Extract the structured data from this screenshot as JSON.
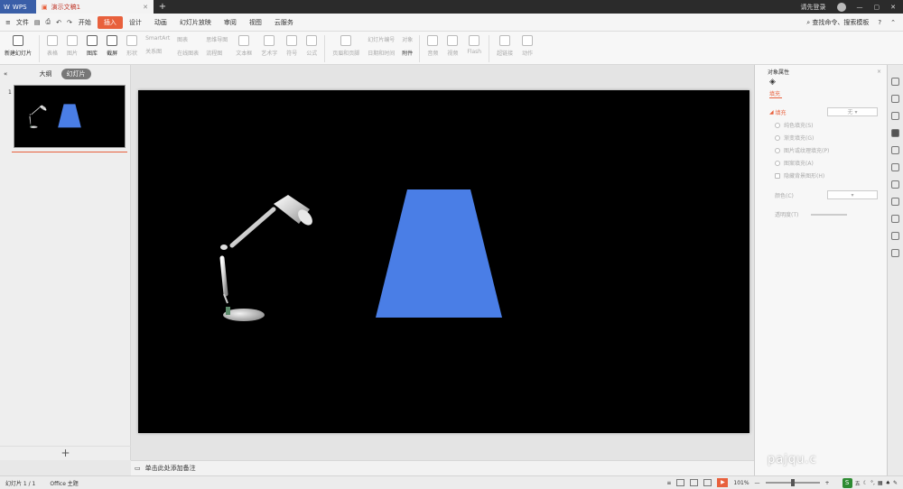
{
  "titlebar": {
    "app_tab": "WPS",
    "doc_tab": "演示文稿1",
    "new_tab": "+",
    "login": "请先登录",
    "controls": [
      "—",
      "▢",
      "✕"
    ]
  },
  "menubar": {
    "file": "文件",
    "items": [
      "开始",
      "插入",
      "设计",
      "动画",
      "幻灯片放映",
      "审阅",
      "视图",
      "云服务"
    ],
    "active": "插入",
    "search": "查找命令、搜索模板",
    "help": "?"
  },
  "ribbon": {
    "new_slide": "新建幻灯片",
    "table": "表格",
    "picture": "图片",
    "gallery": "图库",
    "screenshot": "截屏",
    "shape": "形状",
    "smartart": "SmartArt",
    "relation": "关系图",
    "chart": "图表",
    "online_chart": "在线图表",
    "mindmap": "思维导图",
    "flowchart": "流程图",
    "textbox": "文本框",
    "wordart": "艺术字",
    "symbol": "符号",
    "formula": "公式",
    "header_footer": "页眉和页脚",
    "slide_number": "幻灯片编号",
    "datetime": "日期和时间",
    "object": "对象",
    "attachment": "附件",
    "audio": "音频",
    "video": "视频",
    "flash": "Flash",
    "hyperlink": "超链接",
    "action": "动作"
  },
  "leftpane": {
    "tab_outline": "大纲",
    "tab_slides": "幻灯片",
    "slide_number": "1",
    "add": "+"
  },
  "notes": {
    "placeholder": "单击此处添加备注"
  },
  "rightpane": {
    "title": "对象属性",
    "close": "×",
    "tab_fill": "填充",
    "section_fill": "填充",
    "fill_value": "无",
    "options": [
      "纯色填充(S)",
      "渐变填充(G)",
      "图片或纹理填充(P)",
      "图案填充(A)",
      "隐藏背景图形(H)"
    ],
    "color_label": "颜色(C)",
    "transparency_label": "透明度(T)"
  },
  "statusbar": {
    "slide_info": "幻灯片 1 / 1",
    "theme": "Office 主题",
    "zoom": "101%",
    "zoom_minus": "—",
    "zoom_plus": "+",
    "ime_char": "五",
    "watermark": "pajqu.c"
  },
  "colors": {
    "accent": "#e8603c",
    "trapezoid": "#4a7ee6",
    "slide_bg": "#000000"
  }
}
